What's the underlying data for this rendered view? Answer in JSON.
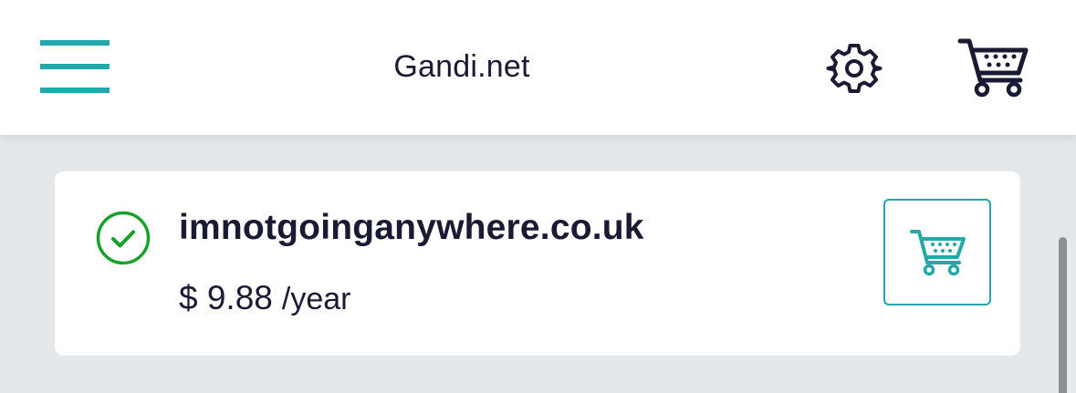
{
  "header": {
    "title": "Gandi.net",
    "menu_icon": "hamburger-menu-icon",
    "settings_icon": "gear-icon",
    "cart_icon": "shopping-cart-icon"
  },
  "result": {
    "domain": "imnotgoinganywhere.co.uk",
    "status_icon": "check-circle-icon",
    "price": "$ 9.88",
    "period": "/year",
    "add_cart_icon": "shopping-cart-icon"
  },
  "colors": {
    "accent": "#25a6a8",
    "available": "#1aa02a",
    "text": "#1a1b33",
    "background": "#e4e8eb"
  }
}
